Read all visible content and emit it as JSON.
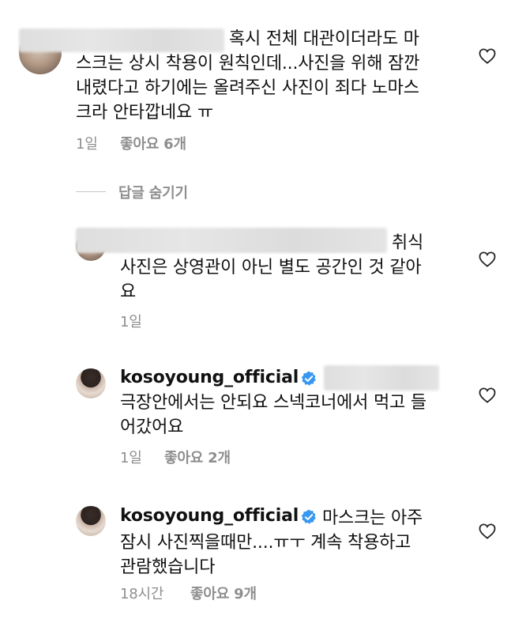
{
  "comments": [
    {
      "lines": [
        "혹시 전체 대관이더라도 마",
        "스크는 상시 착용이 원칙인데...사진을 위해 잠깐",
        "내렸다고 하기에는 올려주신 사진이 죄다 노마스",
        "크라 안타깝네요 ㅠ"
      ],
      "time": "1일",
      "likes": "좋아요 6개"
    },
    {
      "lines": [
        "취식",
        "사진은 상영관이 아닌 별도 공간인 것 같아",
        "요"
      ],
      "time": "1일"
    },
    {
      "username": "kosoyoung_official",
      "lines": [
        "극장안에서는 안되요 스넥코너에서 먹고 들",
        "어갔어요"
      ],
      "time": "1일",
      "likes": "좋아요 2개"
    },
    {
      "username": "kosoyoung_official",
      "lines": [
        "마스크는 아주",
        "잠시 사진찍을때만....ㅠㅜ 계속 착용하고",
        "관람했습니다"
      ],
      "time": "18시간",
      "likes": "좋아요 9개"
    }
  ],
  "hide_replies": "답글 숨기기",
  "icons": {
    "like": "heart-outline-icon",
    "verified": "verified-badge-icon"
  },
  "colors": {
    "verified": "#3897f0",
    "meta": "#8e8e8e",
    "text": "#111111"
  }
}
